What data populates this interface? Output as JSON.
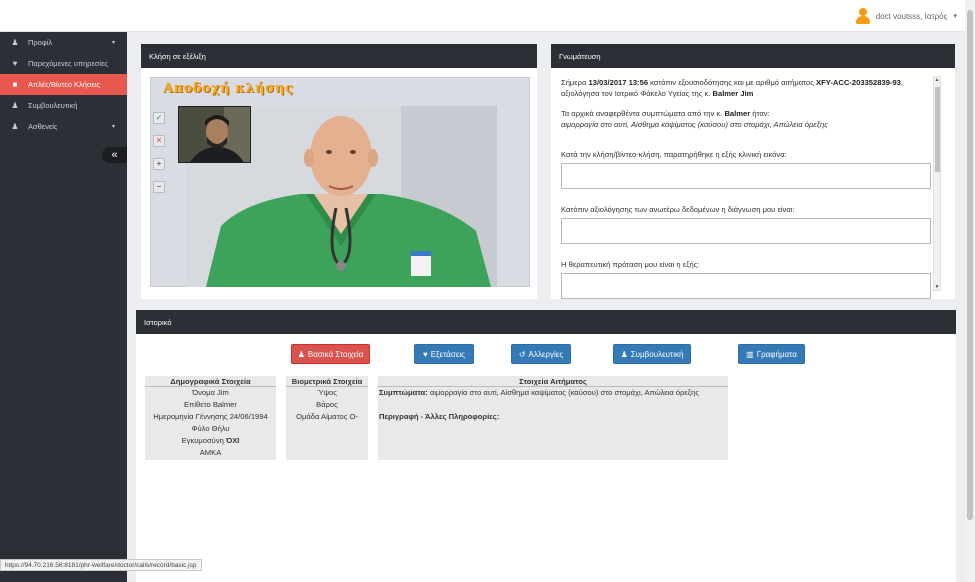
{
  "topbar": {
    "user_label": "doct voutsss, Ιατρός",
    "caret": "▾"
  },
  "sidebar": {
    "items": [
      {
        "icon": "♟",
        "label": "Προφίλ",
        "arrow": "▾"
      },
      {
        "icon": "♥",
        "label": "Παρεχόμενες υπηρεσίες",
        "arrow": ""
      },
      {
        "icon": "■",
        "label": "Απλές/Βίντεο Κλήσεις",
        "arrow": ""
      },
      {
        "icon": "♟",
        "label": "Συμβουλευτική",
        "arrow": ""
      },
      {
        "icon": "♟",
        "label": "Ασθενείς",
        "arrow": "▾"
      }
    ],
    "collapse": "«"
  },
  "call_panel": {
    "title": "Κλήση σε εξέλιξη",
    "accept": "Αποδοχή κλήσης",
    "controls": [
      "✓",
      "✕",
      "+",
      "−"
    ]
  },
  "diagnosis": {
    "title": "Γνωμάτευση",
    "p1_pre": "Σήμερα ",
    "p1_date": "13/03/2017 13:56",
    "p1_mid": " κατόπιν εξουσιοδότησης και με αριθμό αιτήματος ",
    "p1_req": "XFY-ACC-203352839-93",
    "p1_post": ", αξιολόγησα τον Ιατρικό Φάκελο Υγείας της κ. ",
    "p1_name": "Balmer Jim",
    "p2_pre": "Τα αρχικά αναφερθέντα συμπτώματα από την κ. ",
    "p2_name": "Balmer",
    "p2_post": " ήταν:",
    "p2_symptoms": "αιμορραγία στο αυτί, Αίσθημα καψίματος (καύσου) στο στομάχι, Απώλεια όρεξης",
    "label1": "Κατά την κλήση/βίντεο-κλήση, παρατηρήθηκε η εξής κλινική εικόνα:",
    "label2": "Κατόπιν αξιολόγησης των ανωτέρω δεδομένων η διάγνωση μου είναι:",
    "label3": "Η θεραπευτική πρόταση μου είναι η εξής:"
  },
  "history": {
    "title": "Ιστορικό",
    "buttons": {
      "basic": {
        "icon": "♟",
        "label": "Βασικά Στοιχεία"
      },
      "exams": {
        "icon": "♥",
        "label": "Εξετάσεις"
      },
      "allergies": {
        "icon": "↺",
        "label": "Αλλεργίες"
      },
      "consult": {
        "icon": "♟",
        "label": "Συμβουλευτική"
      },
      "charts": {
        "icon": "▥",
        "label": "Γραφήματα"
      }
    },
    "demographic": {
      "header": "Δημογραφικά Στοιχεία",
      "name": "Όνομα Jim",
      "surname": "Επίθετο Balmer",
      "birth": "Ημερομηνία Γέννησης 24/06/1994",
      "gender": "Φύλο Θήλυ",
      "pregnancy_label": "Εγκυμοσύνη ",
      "pregnancy_value": "ΌΧΙ",
      "amka": "ΑΜΚΑ"
    },
    "biometric": {
      "header": "Βιομετρικά Στοιχεία",
      "height": "Ύψος",
      "weight": "Βάρος",
      "blood": "Ομάδα Αίματος O-"
    },
    "request": {
      "header": "Στοιχεία Αιτήματος",
      "symptoms_label": "Συμπτώματα:",
      "symptoms_value": " αιμορραγία στο αυτί, Αίσθημα καψίματος (καύσου) στο στομάχι, Απώλεια όρεξης",
      "desc_label": "Περιγραφή - Άλλες Πληροφορίες:"
    }
  },
  "statusbar": {
    "url": "https://94.70.216.56:8181/phr-wellfare/doctor/calls/record/basic.jsp"
  },
  "colors": {
    "sidebar": "#2c3036",
    "active": "#e9584f",
    "primary": "#337ab7",
    "danger": "#d9534f",
    "accent": "#f39c12"
  }
}
